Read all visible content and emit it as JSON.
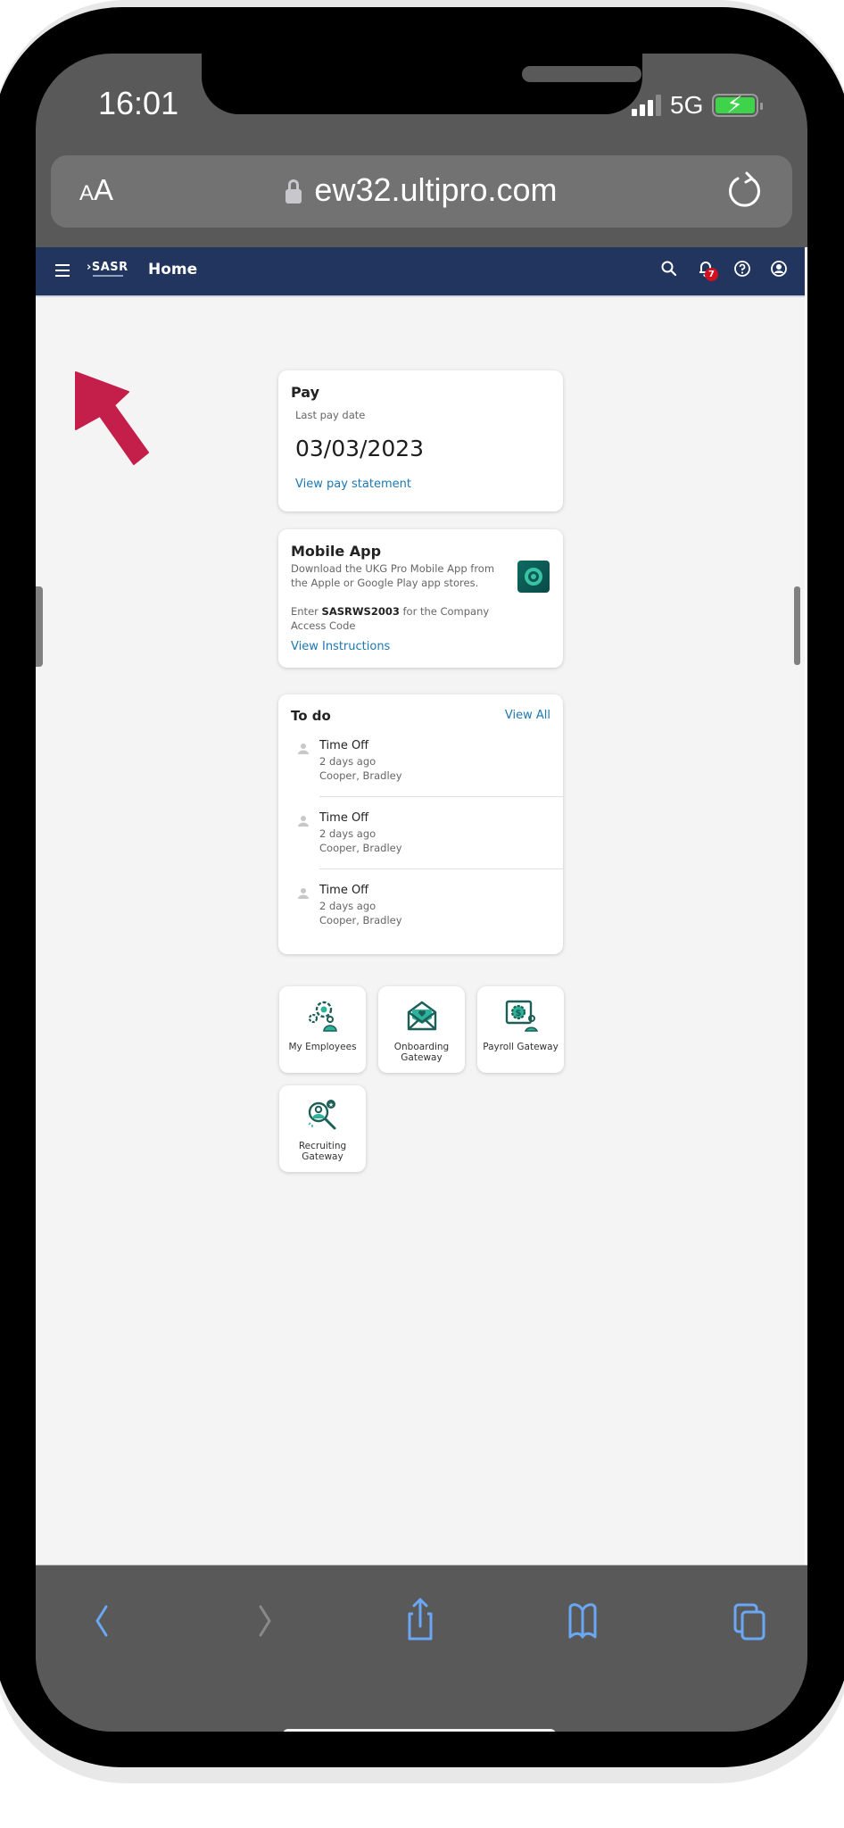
{
  "status_bar": {
    "time": "16:01",
    "network": "5G",
    "battery_charging": true,
    "signal_bars_active": 3,
    "signal_bars_total": 4
  },
  "browser": {
    "text_size_small": "A",
    "text_size_large": "A",
    "url": "ew32.ultipro.com",
    "icons": {
      "lock": "lock-icon",
      "reload": "reload-icon"
    }
  },
  "navbar": {
    "menu_icon": "hamburger-icon",
    "logo_text": "SASR",
    "title": "Home",
    "notification_count": "7",
    "icons": [
      "search-icon",
      "bell-icon",
      "help-icon",
      "account-icon"
    ],
    "background_color": "#21355f"
  },
  "pay_card": {
    "title": "Pay",
    "subtitle": "Last pay date",
    "date": "03/03/2023",
    "link": "View pay statement"
  },
  "mobile_app_card": {
    "title": "Mobile App",
    "description": "Download the UKG Pro Mobile App from the Apple or Google Play app stores.",
    "code_prefix": "Enter ",
    "code": "SASRWS2003",
    "code_suffix": " for the Company Access Code",
    "link": "View Instructions"
  },
  "todo_card": {
    "title": "To do",
    "view_all": "View All",
    "items": [
      {
        "title": "Time Off",
        "time": "2 days ago",
        "name": "Cooper, Bradley"
      },
      {
        "title": "Time Off",
        "time": "2 days ago",
        "name": "Cooper, Bradley"
      },
      {
        "title": "Time Off",
        "time": "2 days ago",
        "name": "Cooper, Bradley"
      }
    ]
  },
  "tiles": [
    {
      "label": "My Employees",
      "icon": "employees-gear-icon"
    },
    {
      "label": "Onboarding Gateway",
      "icon": "envelope-heart-icon"
    },
    {
      "label": "Payroll Gateway",
      "icon": "payroll-gear-icon"
    },
    {
      "label": "Recruiting Gateway",
      "icon": "recruiting-search-icon"
    }
  ],
  "annotation": {
    "arrow_color": "#c41e4a",
    "points_to": "hamburger-menu"
  },
  "toolbar": {
    "buttons": [
      "back-icon",
      "forward-icon",
      "share-icon",
      "bookmarks-icon",
      "tabs-icon"
    ]
  },
  "colors": {
    "link": "#1c77b4",
    "accent_teal": "#0a7a6e",
    "toolbar_icon": "#6aa8f5"
  }
}
